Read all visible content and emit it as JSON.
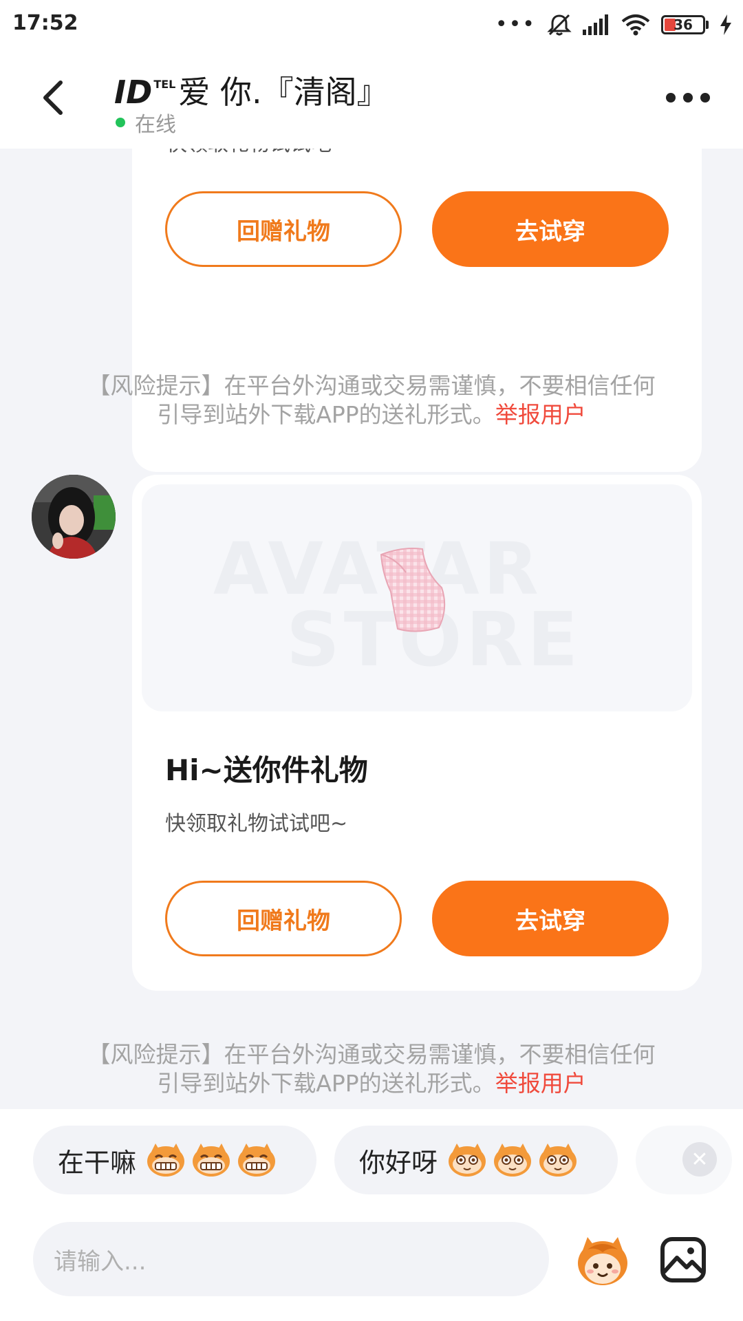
{
  "status_bar": {
    "time": "17:52",
    "battery": "36",
    "icons": [
      "more-dots-icon",
      "mute-icon",
      "signal-icon",
      "wifi-icon",
      "battery-icon",
      "charging-icon"
    ]
  },
  "header": {
    "title_id": "ID",
    "title_tel": "TEL",
    "title_name": "爱 你.『清阁』",
    "status": "在线",
    "status_color": "#22c35a"
  },
  "messages": {
    "card1": {
      "subtitle": "快领取礼物试试吧~",
      "return_gift_label": "回赠礼物",
      "try_on_label": "去试穿"
    },
    "risk1": {
      "text_line1": "【风险提示】在平台外沟通或交易需谨慎，不要相信任何",
      "text_line2": "引导到站外下载APP的送礼形式。",
      "report_label": "举报用户"
    },
    "card2": {
      "watermark_line1": "AVATAR",
      "watermark_line2": "STORE",
      "title": "Hi~送你件礼物",
      "subtitle": "快领取礼物试试吧~",
      "return_gift_label": "回赠礼物",
      "try_on_label": "去试穿"
    },
    "risk2": {
      "text_line1": "【风险提示】在平台外沟通或交易需谨慎，不要相信任何",
      "text_line2": "引导到站外下载APP的送礼形式。",
      "report_label": "举报用户"
    }
  },
  "quick_replies": [
    {
      "text": "在干嘛",
      "emoji": "grinning-monkey-icon"
    },
    {
      "text": "你好呀",
      "emoji": "smiling-monkey-icon"
    }
  ],
  "input": {
    "placeholder": "请输入..."
  },
  "colors": {
    "accent": "#fa7418",
    "report": "#f04a3c",
    "background": "#f3f4f8"
  }
}
